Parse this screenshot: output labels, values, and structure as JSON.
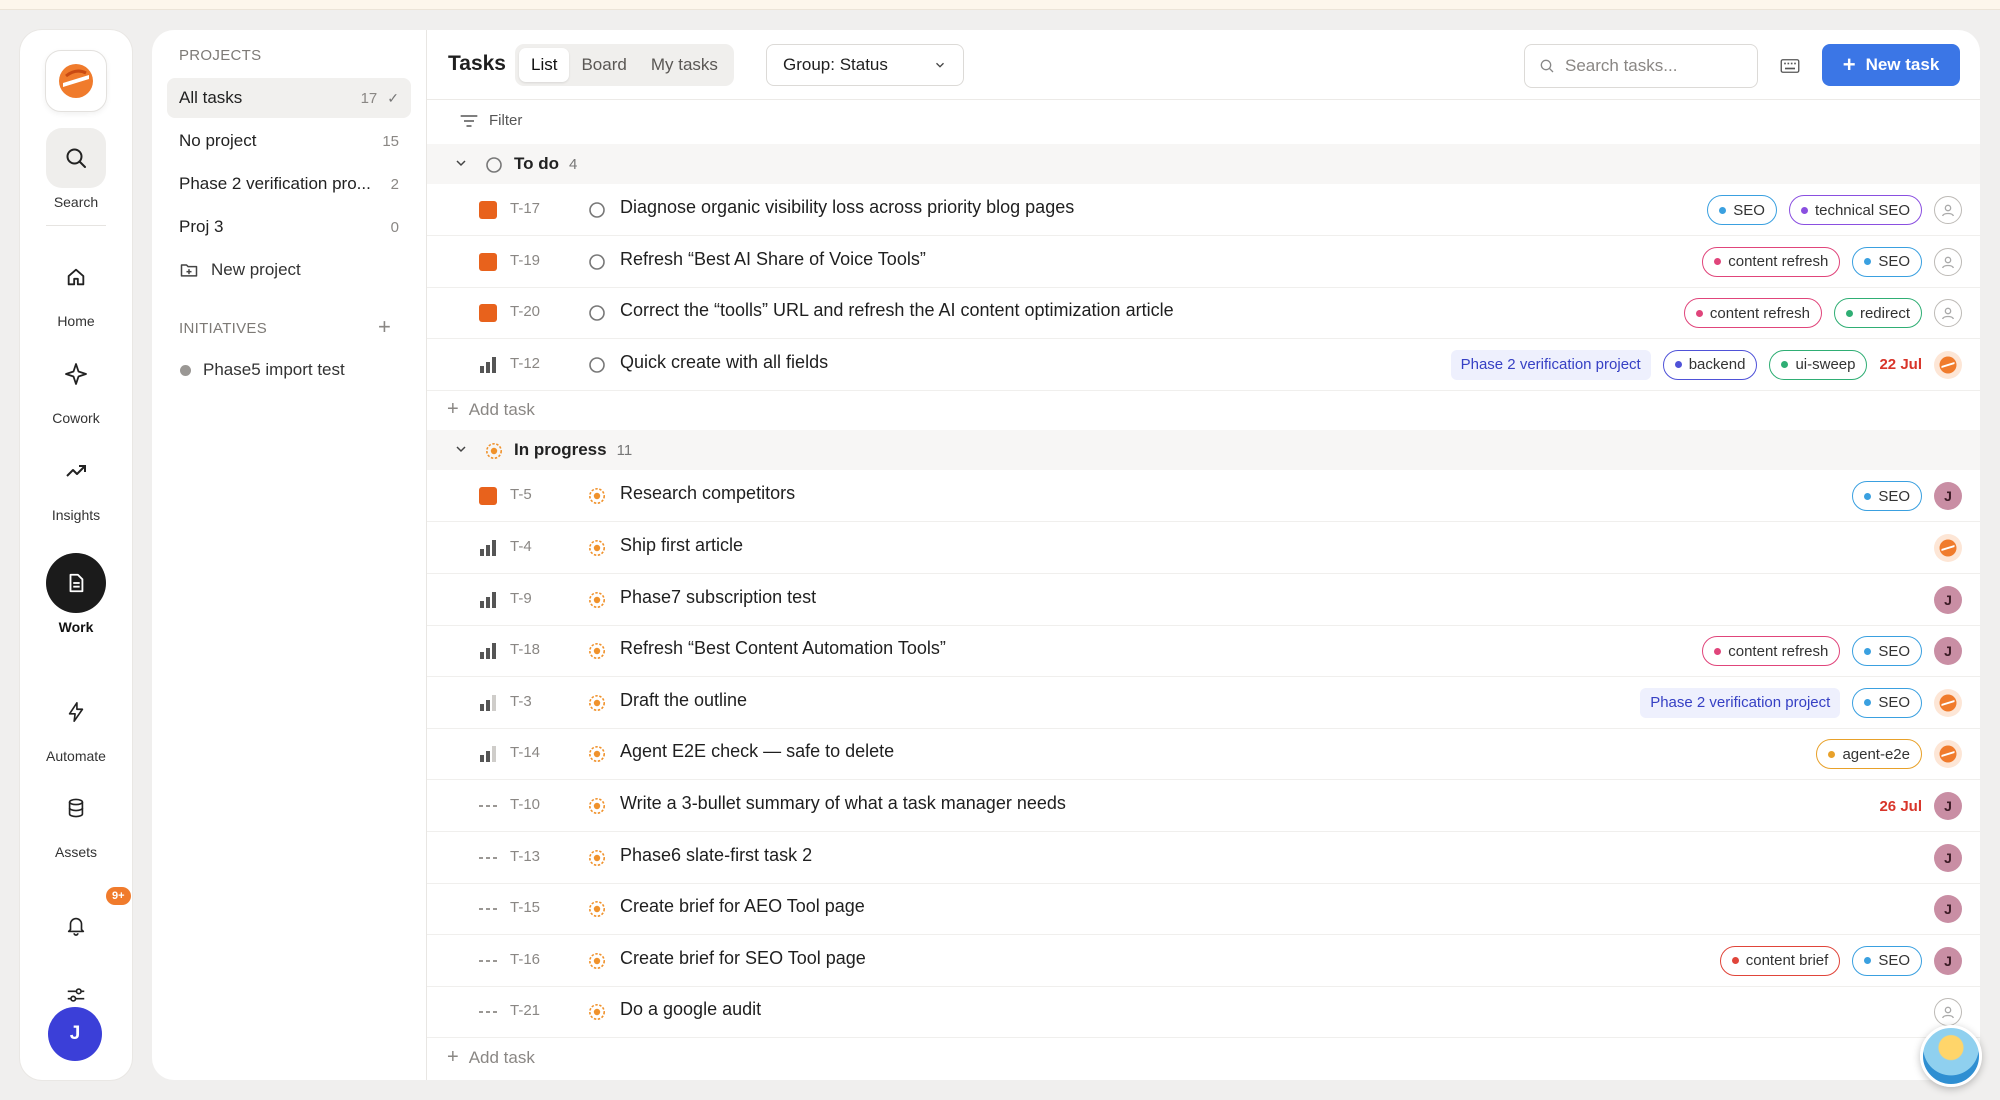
{
  "rail": {
    "items": [
      {
        "label": "Search"
      },
      {
        "label": "Home"
      },
      {
        "label": "Cowork"
      },
      {
        "label": "Insights"
      },
      {
        "label": "Work"
      },
      {
        "label": "Automate"
      },
      {
        "label": "Assets"
      }
    ],
    "notifications_badge": "9+",
    "user_initial": "J"
  },
  "projects": {
    "heading": "PROJECTS",
    "items": [
      {
        "name": "All tasks",
        "count": "17"
      },
      {
        "name": "No project",
        "count": "15"
      },
      {
        "name": "Phase 2 verification pro...",
        "count": "2"
      },
      {
        "name": "Proj 3",
        "count": "0"
      }
    ],
    "new_project": "New project",
    "initiatives_heading": "INITIATIVES",
    "initiatives": [
      {
        "name": "Phase5 import test"
      }
    ]
  },
  "toolbar": {
    "title": "Tasks",
    "views": [
      "List",
      "Board",
      "My tasks"
    ],
    "active_view": "List",
    "group_by": "Group: Status",
    "search_placeholder": "Search tasks...",
    "new_task": "New task",
    "filter": "Filter"
  },
  "groups": [
    {
      "title": "To do",
      "count": "4",
      "add_task": "Add task",
      "tasks": [
        {
          "id": "T-17",
          "priority": "urgent",
          "title": "Diagnose organic visibility loss across priority blog pages",
          "tags": [
            {
              "label": "SEO",
              "color": "#3aa0e0"
            },
            {
              "label": "technical SEO",
              "color": "#8a4fe0"
            }
          ],
          "assignee": "unassigned"
        },
        {
          "id": "T-19",
          "priority": "urgent",
          "title": "Refresh “Best AI Share of Voice Tools”",
          "tags": [
            {
              "label": "content refresh",
              "color": "#e0457b"
            },
            {
              "label": "SEO",
              "color": "#3aa0e0"
            }
          ],
          "assignee": "unassigned"
        },
        {
          "id": "T-20",
          "priority": "urgent",
          "title": "Correct the “toolls” URL and refresh the AI content optimization article",
          "tags": [
            {
              "label": "content refresh",
              "color": "#e0457b"
            },
            {
              "label": "redirect",
              "color": "#2fae74"
            }
          ],
          "assignee": "unassigned"
        },
        {
          "id": "T-12",
          "priority": "high",
          "title": "Quick create with all fields",
          "project": "Phase 2 verification project",
          "tags": [
            {
              "label": "backend",
              "color": "#4f52d8"
            },
            {
              "label": "ui-sweep",
              "color": "#2fae74"
            }
          ],
          "date": "22 Jul",
          "assignee": "bot"
        }
      ]
    },
    {
      "title": "In progress",
      "count": "11",
      "add_task": "Add task",
      "tasks": [
        {
          "id": "T-5",
          "priority": "urgent",
          "title": "Research competitors",
          "tags": [
            {
              "label": "SEO",
              "color": "#3aa0e0"
            }
          ],
          "assignee": "J"
        },
        {
          "id": "T-4",
          "priority": "high",
          "title": "Ship first article",
          "tags": [],
          "assignee": "bot"
        },
        {
          "id": "T-9",
          "priority": "high",
          "title": "Phase7 subscription test",
          "tags": [],
          "assignee": "J"
        },
        {
          "id": "T-18",
          "priority": "high",
          "title": "Refresh “Best Content Automation Tools”",
          "tags": [
            {
              "label": "content refresh",
              "color": "#e0457b"
            },
            {
              "label": "SEO",
              "color": "#3aa0e0"
            }
          ],
          "assignee": "J"
        },
        {
          "id": "T-3",
          "priority": "medium",
          "title": "Draft the outline",
          "project": "Phase 2 verification project",
          "tags": [
            {
              "label": "SEO",
              "color": "#3aa0e0"
            }
          ],
          "assignee": "bot"
        },
        {
          "id": "T-14",
          "priority": "medium",
          "title": "Agent E2E check — safe to delete",
          "tags": [
            {
              "label": "agent-e2e",
              "color": "#e8a12a"
            }
          ],
          "assignee": "bot"
        },
        {
          "id": "T-10",
          "priority": "none",
          "title": "Write a 3-bullet summary of what a task manager needs",
          "tags": [],
          "date": "26 Jul",
          "assignee": "J"
        },
        {
          "id": "T-13",
          "priority": "none",
          "title": "Phase6 slate-first task 2",
          "tags": [],
          "assignee": "J"
        },
        {
          "id": "T-15",
          "priority": "none",
          "title": "Create brief for AEO Tool page",
          "tags": [],
          "assignee": "J"
        },
        {
          "id": "T-16",
          "priority": "none",
          "title": "Create brief for SEO Tool page",
          "tags": [
            {
              "label": "content brief",
              "color": "#e0453a"
            },
            {
              "label": "SEO",
              "color": "#3aa0e0"
            }
          ],
          "assignee": "J"
        },
        {
          "id": "T-21",
          "priority": "none",
          "title": "Do a google audit",
          "tags": [],
          "assignee": "unassigned"
        }
      ]
    }
  ],
  "colors": {
    "accent": "#3b76e6",
    "brand": "#f07b2c",
    "urgent": "#e8621c",
    "date": "#d8352a",
    "project_chip_text": "#3640c4"
  }
}
